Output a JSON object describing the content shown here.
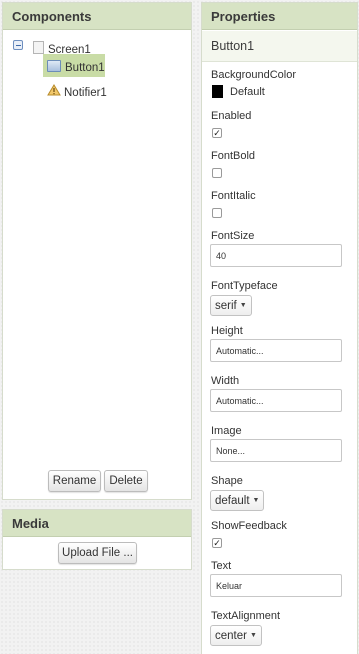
{
  "components": {
    "title": "Components",
    "tree": {
      "screen": "Screen1",
      "children": [
        "Button1",
        "Notifier1"
      ]
    },
    "rename_label": "Rename",
    "delete_label": "Delete"
  },
  "media": {
    "title": "Media",
    "upload_label": "Upload File ..."
  },
  "properties": {
    "title": "Properties",
    "component": "Button1",
    "background_color": {
      "label": "BackgroundColor",
      "value": "Default",
      "color": "#000000"
    },
    "enabled": {
      "label": "Enabled",
      "checked": true
    },
    "font_bold": {
      "label": "FontBold",
      "checked": false
    },
    "font_italic": {
      "label": "FontItalic",
      "checked": false
    },
    "font_size": {
      "label": "FontSize",
      "value": "40"
    },
    "font_typeface": {
      "label": "FontTypeface",
      "value": "serif"
    },
    "height": {
      "label": "Height",
      "value": "Automatic..."
    },
    "width": {
      "label": "Width",
      "value": "Automatic..."
    },
    "image": {
      "label": "Image",
      "value": "None..."
    },
    "shape": {
      "label": "Shape",
      "value": "default"
    },
    "show_feedback": {
      "label": "ShowFeedback",
      "checked": true
    },
    "text": {
      "label": "Text",
      "value": "Keluar"
    },
    "text_alignment": {
      "label": "TextAlignment",
      "value": "center"
    }
  },
  "colors": {
    "header_bg": "#d7e3c4",
    "selected_bg": "#c9dca6"
  }
}
